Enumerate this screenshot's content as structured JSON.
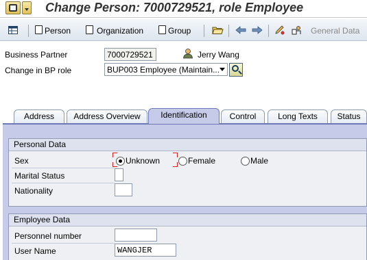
{
  "title": "Change Person: 7000729521, role Employee",
  "toolbar": {
    "person": "Person",
    "organization": "Organization",
    "group": "Group",
    "general_data": "General Data"
  },
  "header": {
    "business_partner_label": "Business Partner",
    "business_partner_value": "7000729521",
    "person_name": "Jerry Wang",
    "bp_role_label": "Change in BP role",
    "bp_role_value": "BUP003 Employee (Maintain..."
  },
  "tabs": [
    {
      "label": "Address",
      "active": false
    },
    {
      "label": "Address Overview",
      "active": false
    },
    {
      "label": "Identification",
      "active": true
    },
    {
      "label": "Control",
      "active": false
    },
    {
      "label": "Long Texts",
      "active": false
    },
    {
      "label": "Status",
      "active": false
    }
  ],
  "personal_data": {
    "title": "Personal Data",
    "sex_label": "Sex",
    "sex_options": [
      "Unknown",
      "Female",
      "Male"
    ],
    "sex_selected": "Unknown",
    "marital_status_label": "Marital Status",
    "marital_status_value": "",
    "nationality_label": "Nationality",
    "nationality_value": ""
  },
  "employee_data": {
    "title": "Employee Data",
    "personnel_number_label": "Personnel number",
    "personnel_number_value": "",
    "user_name_label": "User Name",
    "user_name_value": "WANGJER"
  },
  "colors": {
    "tab_active": "#c6cbe9",
    "panel_bg": "#c6cbe9",
    "group_bg": "#eef0f3",
    "focus_mark": "#d12020"
  }
}
